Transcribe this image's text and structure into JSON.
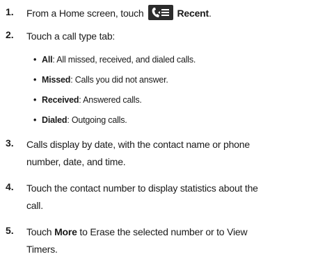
{
  "steps": [
    {
      "num": "1.",
      "before": "From a Home screen, touch",
      "icon": "recent-calls-icon",
      "bold": "Recent",
      "after": "."
    },
    {
      "num": "2.",
      "text": "Touch a call type tab:"
    },
    {
      "num": "3.",
      "line1": "Calls display by date, with the contact name or phone",
      "line2": "number, date, and time."
    },
    {
      "num": "4.",
      "line1": "Touch the contact number to display statistics about the",
      "line2": "call."
    },
    {
      "num": "5.",
      "prefix": "Touch ",
      "bold": "More",
      "line1_rest": " to Erase the selected number or to View",
      "line2": "Timers."
    }
  ],
  "tabs": [
    {
      "bullet": "•",
      "name": "All",
      "desc": ": All missed, received, and dialed calls."
    },
    {
      "bullet": "•",
      "name": "Missed",
      "desc": ": Calls you did not answer."
    },
    {
      "bullet": "•",
      "name": "Received",
      "desc": ": Answered calls."
    },
    {
      "bullet": "•",
      "name": "Dialed",
      "desc": ": Outgoing calls."
    }
  ]
}
